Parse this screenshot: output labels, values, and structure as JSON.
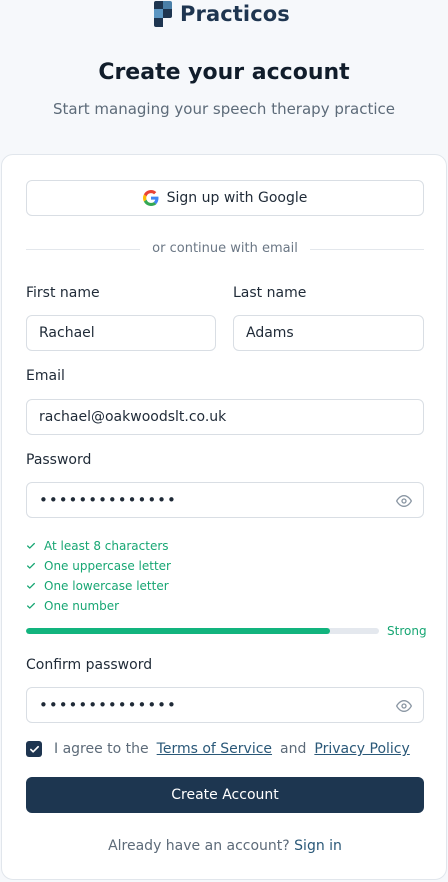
{
  "brand": {
    "name": "Practicos",
    "colors": {
      "primary": "#1d3650",
      "success": "#12b47e",
      "link": "#2a5878"
    }
  },
  "header": {
    "title": "Create your account",
    "subtitle": "Start managing your speech therapy practice"
  },
  "google_button": {
    "label": "Sign up with Google",
    "icon": "google-icon"
  },
  "divider_text": "or continue with email",
  "fields": {
    "first_name": {
      "label": "First name",
      "value": "Rachael"
    },
    "last_name": {
      "label": "Last name",
      "value": "Adams"
    },
    "email": {
      "label": "Email",
      "value": "rachael@oakwoodslt.co.uk"
    },
    "password": {
      "label": "Password",
      "value": "••••••••••••••",
      "icon": "eye-icon"
    },
    "confirm_password": {
      "label": "Confirm password",
      "value": "••••••••••••••",
      "icon": "eye-icon"
    }
  },
  "requirements": [
    {
      "label": "At least 8 characters",
      "met": true
    },
    {
      "label": "One uppercase letter",
      "met": true
    },
    {
      "label": "One lowercase letter",
      "met": true
    },
    {
      "label": "One number",
      "met": true
    }
  ],
  "strength": {
    "label": "Strong",
    "level": 0.86
  },
  "terms": {
    "checked": true,
    "prefix": "I agree to the",
    "terms_link": "Terms of Service",
    "and": "and",
    "privacy_link": "Privacy Policy"
  },
  "submit": {
    "label": "Create Account"
  },
  "footer": {
    "text": "Already have an account?",
    "link": "Sign in"
  }
}
